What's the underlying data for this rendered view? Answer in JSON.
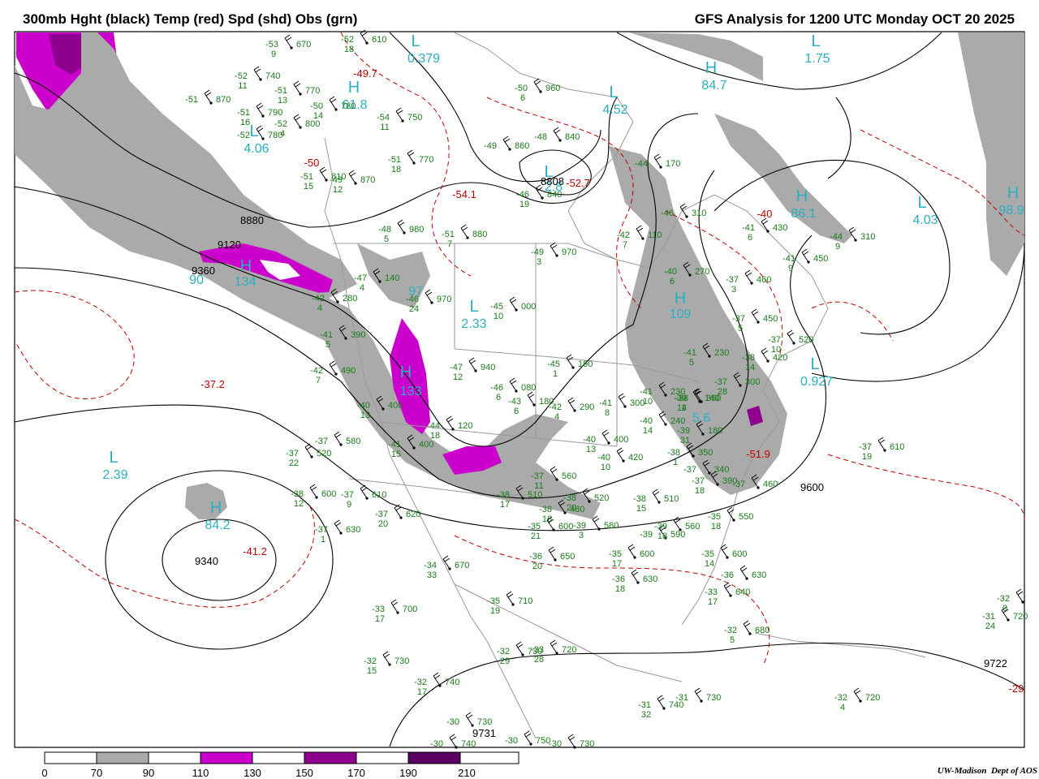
{
  "header": {
    "title_left": "300mb Hght (black) Temp (red) Spd (shd) Obs (grn)",
    "title_right": "GFS Analysis for 1200 UTC Monday  OCT 20 2025"
  },
  "colors": {
    "height_contour": "#000000",
    "temperature_contour": "#c00000",
    "observation": "#1a7a1a",
    "high_low_label": "#2ab0c0",
    "wind_70_90": "#aaaaaa",
    "wind_110_130": "#cc00cc",
    "wind_150_170": "#8e008e",
    "wind_190_210": "#5a0060",
    "land_border": "#9a9a9a"
  },
  "map": {
    "centers": [
      {
        "type": "L",
        "value": "0.379"
      },
      {
        "type": "L",
        "value": "1.75"
      },
      {
        "type": "H",
        "value": "61.8"
      },
      {
        "type": "H",
        "value": "84.7"
      },
      {
        "type": "L",
        "value": "4.52"
      },
      {
        "type": "L",
        "value": "4.06"
      },
      {
        "type": "L",
        "value": "2.8"
      },
      {
        "type": "H",
        "value": "86.1"
      },
      {
        "type": "L",
        "value": "4.03"
      },
      {
        "type": "H",
        "value": "98.9"
      },
      {
        "type": "H",
        "value": "134"
      },
      {
        "type": "H",
        "value": "90"
      },
      {
        "type": "L",
        "value": "2.33"
      },
      {
        "type": "H",
        "value": "109"
      },
      {
        "type": "L",
        "value": "0.927"
      },
      {
        "type": "H",
        "value": "133"
      },
      {
        "type": "H",
        "value": "5.6"
      },
      {
        "type": "L",
        "value": "2.39"
      },
      {
        "type": "H",
        "value": "84.2"
      },
      {
        "type": "H",
        "value": "97"
      }
    ],
    "temperature_labels": [
      "-49.7",
      "-54.1",
      "-52.7",
      "-50",
      "-37.2",
      "-41.2",
      "-51.9",
      "-40",
      "-29"
    ],
    "height_labels": [
      "8880",
      "9120",
      "9360",
      "8808",
      "9340",
      "9600",
      "9731",
      "9722"
    ],
    "observations": [
      {
        "t": "-53",
        "h": "670",
        "d": "9"
      },
      {
        "t": "-52",
        "h": "610",
        "d": "18"
      },
      {
        "t": "-52",
        "h": "740",
        "d": "11"
      },
      {
        "t": "-51",
        "h": "870",
        "d": ""
      },
      {
        "t": "-51",
        "h": "770",
        "d": "13"
      },
      {
        "t": "-51",
        "h": "790",
        "d": "16"
      },
      {
        "t": "-52",
        "h": "800",
        "d": "4"
      },
      {
        "t": "-52",
        "h": "780",
        "d": ""
      },
      {
        "t": "-50",
        "h": "780",
        "d": "14"
      },
      {
        "t": "-54",
        "h": "750",
        "d": "11"
      },
      {
        "t": "-50",
        "h": "960",
        "d": "6"
      },
      {
        "t": "-49",
        "h": "860",
        "d": ""
      },
      {
        "t": "-51",
        "h": "770",
        "d": "18"
      },
      {
        "t": "-48",
        "h": "840",
        "d": ""
      },
      {
        "t": "-46",
        "h": "840",
        "d": "19"
      },
      {
        "t": "-51",
        "h": "810",
        "d": "15"
      },
      {
        "t": "-49",
        "h": "870",
        "d": "12"
      },
      {
        "t": "-48",
        "h": "980",
        "d": "5"
      },
      {
        "t": "-51",
        "h": "880",
        "d": "7"
      },
      {
        "t": "-49",
        "h": "970",
        "d": "3"
      },
      {
        "t": "-44",
        "h": "170",
        "d": ""
      },
      {
        "t": "-46",
        "h": "310",
        "d": ""
      },
      {
        "t": "-41",
        "h": "430",
        "d": "6"
      },
      {
        "t": "-44",
        "h": "310",
        "d": "9"
      },
      {
        "t": "-42",
        "h": "110",
        "d": "7"
      },
      {
        "t": "-47",
        "h": "140",
        "d": "4"
      },
      {
        "t": "-42",
        "h": "280",
        "d": "4"
      },
      {
        "t": "-46",
        "h": "970",
        "d": "24"
      },
      {
        "t": "-45",
        "h": "000",
        "d": "10"
      },
      {
        "t": "-40",
        "h": "270",
        "d": "6"
      },
      {
        "t": "-41",
        "h": "450",
        "d": "9"
      },
      {
        "t": "-37",
        "h": "460",
        "d": "3"
      },
      {
        "t": "-37",
        "h": "450",
        "d": "5"
      },
      {
        "t": "-37",
        "h": "520",
        "d": "10"
      },
      {
        "t": "-41",
        "h": "390",
        "d": "5"
      },
      {
        "t": "-47",
        "h": "940",
        "d": "12"
      },
      {
        "t": "-45",
        "h": "190",
        "d": "1"
      },
      {
        "t": "-41",
        "h": "230",
        "d": "5"
      },
      {
        "t": "-38",
        "h": "420",
        "d": "14"
      },
      {
        "t": "-42",
        "h": "490",
        "d": "7"
      },
      {
        "t": "-46",
        "h": "080",
        "d": "6"
      },
      {
        "t": "-43",
        "h": "180",
        "d": "6"
      },
      {
        "t": "-42",
        "h": "290",
        "d": "4"
      },
      {
        "t": "-41",
        "h": "300",
        "d": "8"
      },
      {
        "t": "-41",
        "h": "230",
        "d": "10"
      },
      {
        "t": "-37",
        "h": "300",
        "d": "28"
      },
      {
        "t": "-38",
        "h": "350",
        "d": "1"
      },
      {
        "t": "-40",
        "h": "400",
        "d": "13"
      },
      {
        "t": "-40",
        "h": "240",
        "d": "14"
      },
      {
        "t": "-39",
        "h": "140",
        "d": "14"
      },
      {
        "t": "-39",
        "h": "180",
        "d": "31"
      },
      {
        "t": "-44",
        "h": "120",
        "d": "18"
      },
      {
        "t": "-40",
        "h": "400",
        "d": "13"
      },
      {
        "t": "-41",
        "h": "400",
        "d": "15"
      },
      {
        "t": "-37",
        "h": "580",
        "d": ""
      },
      {
        "t": "-37",
        "h": "520",
        "d": "22"
      },
      {
        "t": "-40",
        "h": "420",
        "d": "10"
      },
      {
        "t": "-38",
        "h": "350",
        "d": "1"
      },
      {
        "t": "-37",
        "h": "340",
        "d": ""
      },
      {
        "t": "-37",
        "h": "390",
        "d": "18"
      },
      {
        "t": "-37",
        "h": "460",
        "d": ""
      },
      {
        "t": "-37",
        "h": "610",
        "d": "19"
      },
      {
        "t": "-38",
        "h": "600",
        "d": "12"
      },
      {
        "t": "-37",
        "h": "610",
        "d": "9"
      },
      {
        "t": "-37",
        "h": "620",
        "d": "20"
      },
      {
        "t": "-38",
        "h": "510",
        "d": "17"
      },
      {
        "t": "-38",
        "h": "520",
        "d": "20"
      },
      {
        "t": "-38",
        "h": "480",
        "d": "16"
      },
      {
        "t": "-37",
        "h": "560",
        "d": "11"
      },
      {
        "t": "-38",
        "h": "510",
        "d": "15"
      },
      {
        "t": "-35",
        "h": "550",
        "d": "18"
      },
      {
        "t": "-37",
        "h": "630",
        "d": "1"
      },
      {
        "t": "-35",
        "h": "600",
        "d": "21"
      },
      {
        "t": "-39",
        "h": "580",
        "d": "3"
      },
      {
        "t": "-39",
        "h": "590",
        "d": ""
      },
      {
        "t": "-39",
        "h": "560",
        "d": "18"
      },
      {
        "t": "-35",
        "h": "600",
        "d": "14"
      },
      {
        "t": "-36",
        "h": "650",
        "d": "20"
      },
      {
        "t": "-34",
        "h": "670",
        "d": "33"
      },
      {
        "t": "-35",
        "h": "600",
        "d": "17"
      },
      {
        "t": "-36",
        "h": "630",
        "d": "18"
      },
      {
        "t": "-36",
        "h": "630",
        "d": ""
      },
      {
        "t": "-33",
        "h": "640",
        "d": "17"
      },
      {
        "t": "-33",
        "h": "700",
        "d": "17"
      },
      {
        "t": "-35",
        "h": "710",
        "d": "19"
      },
      {
        "t": "-32",
        "h": "680",
        "d": "5"
      },
      {
        "t": "-32",
        "h": "730",
        "d": "29"
      },
      {
        "t": "-33",
        "h": "720",
        "d": "28"
      },
      {
        "t": "-32",
        "h": "730",
        "d": "15"
      },
      {
        "t": "-32",
        "h": "740",
        "d": "17"
      },
      {
        "t": "-31",
        "h": "740",
        "d": "32"
      },
      {
        "t": "-31",
        "h": "730",
        "d": ""
      },
      {
        "t": "-31",
        "h": "720",
        "d": "24"
      },
      {
        "t": "-32",
        "h": "720",
        "d": "4"
      },
      {
        "t": "-32",
        "h": "",
        "d": "0"
      },
      {
        "t": "-30",
        "h": "730",
        "d": ""
      },
      {
        "t": "-30",
        "h": "740",
        "d": ""
      },
      {
        "t": "-30",
        "h": "750",
        "d": ""
      },
      {
        "t": "-30",
        "h": "730",
        "d": ""
      }
    ]
  },
  "legend": {
    "ticks": [
      "0",
      "70",
      "90",
      "110",
      "130",
      "150",
      "170",
      "190",
      "210"
    ]
  },
  "credit": {
    "institution": "UW-Madison",
    "department": "Dept of AOS"
  }
}
